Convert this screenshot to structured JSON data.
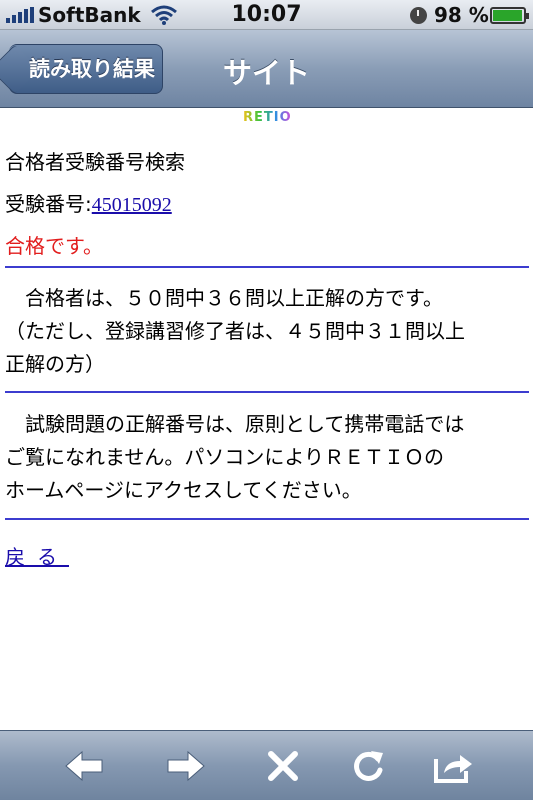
{
  "status_bar": {
    "carrier": "SoftBank",
    "time": "10:07",
    "battery_percent": "98 %",
    "battery_level": 0.98
  },
  "nav": {
    "back_label": "読み取り結果",
    "title": "サイト"
  },
  "page": {
    "logo_text": "RETIO",
    "heading": "合格者受験番号検索",
    "exam_label": "受験番号:",
    "exam_number": "45015092",
    "result": "合格です。",
    "criteria_line1": "　合格者は、５０問中３６問以上正解の方です。",
    "criteria_line2": "（ただし、登録講習修了者は、４５問中３１問以上",
    "criteria_line3": "正解の方）",
    "notice_line1": "　試験問題の正解番号は、原則として携帯電話では",
    "notice_line2": "ご覧になれません。パソコンによりＲＥＴＩＯの",
    "notice_line3": "ホームページにアクセスしてください。",
    "back_link": "戻る"
  },
  "toolbar": {
    "buttons": [
      "back-arrow-icon",
      "forward-arrow-icon",
      "stop-icon",
      "reload-icon",
      "share-icon"
    ]
  },
  "colors": {
    "link": "#1a0dab",
    "result": "#e21d1d",
    "divider": "#3c3ccf"
  }
}
